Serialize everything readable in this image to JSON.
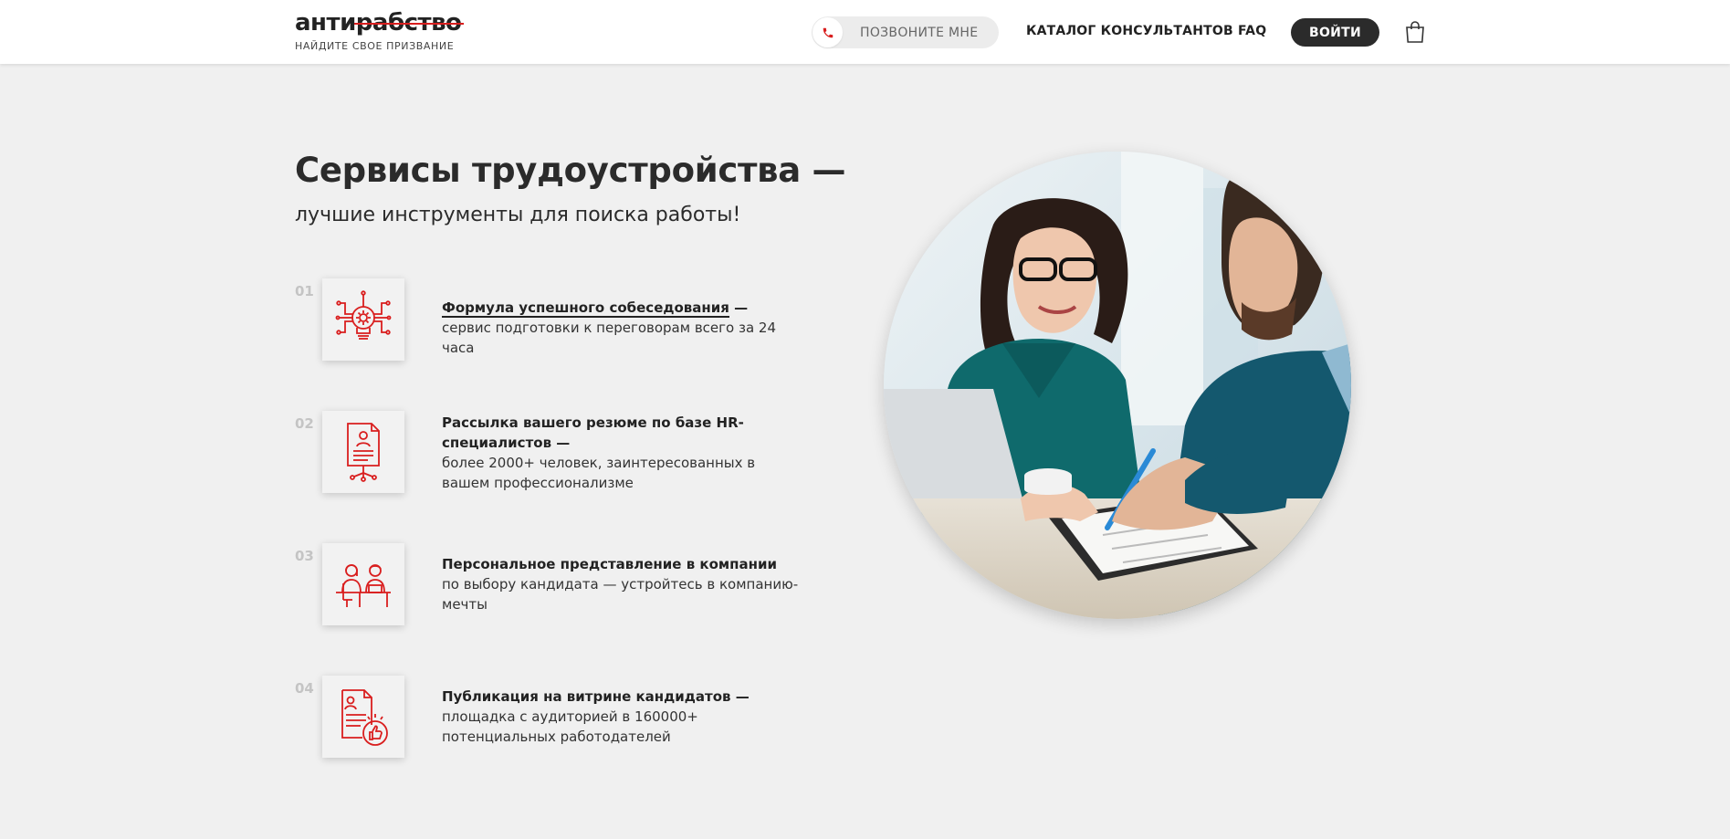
{
  "header": {
    "logo": {
      "main": "анти",
      "struck": "рабство",
      "tagline": "НАЙДИТЕ СВОЕ ПРИЗВАНИЕ"
    },
    "call_me_label": "ПОЗВОНИТЕ МНЕ",
    "nav": {
      "catalog": "КАТАЛОГ КОНСУЛЬТАНТОВ",
      "faq": "FAQ"
    },
    "login_label": "ВОЙТИ",
    "cart_icon": "shopping-bag-icon",
    "accent_color": "#d91e1e"
  },
  "hero": {
    "title": "Сервисы трудоустройства —",
    "subtitle": "лучшие инструменты для поиска работы!"
  },
  "services": [
    {
      "num": "01",
      "icon": "lightbulb-gear-icon",
      "title": "Формула успешного собеседования",
      "dash": " —",
      "desc": "сервис подготовки к переговорам всего за 24 часа"
    },
    {
      "num": "02",
      "icon": "resume-document-icon",
      "title": "Рассылка вашего резюме по базе HR-специалистов —",
      "desc": "более 2000+ человек, заинтересованных в вашем профессионализме"
    },
    {
      "num": "03",
      "icon": "interview-people-icon",
      "title": "Персональное представление в компании",
      "desc": "по выбору кандидата — устройтесь в компанию-мечты"
    },
    {
      "num": "04",
      "icon": "resume-approved-icon",
      "title": "Публикация на витрине кандидатов —",
      "desc": " площадка с аудиторией в 160000+ потенциальных работодателей"
    }
  ],
  "photo": {
    "alt": "office-meeting-photo"
  }
}
